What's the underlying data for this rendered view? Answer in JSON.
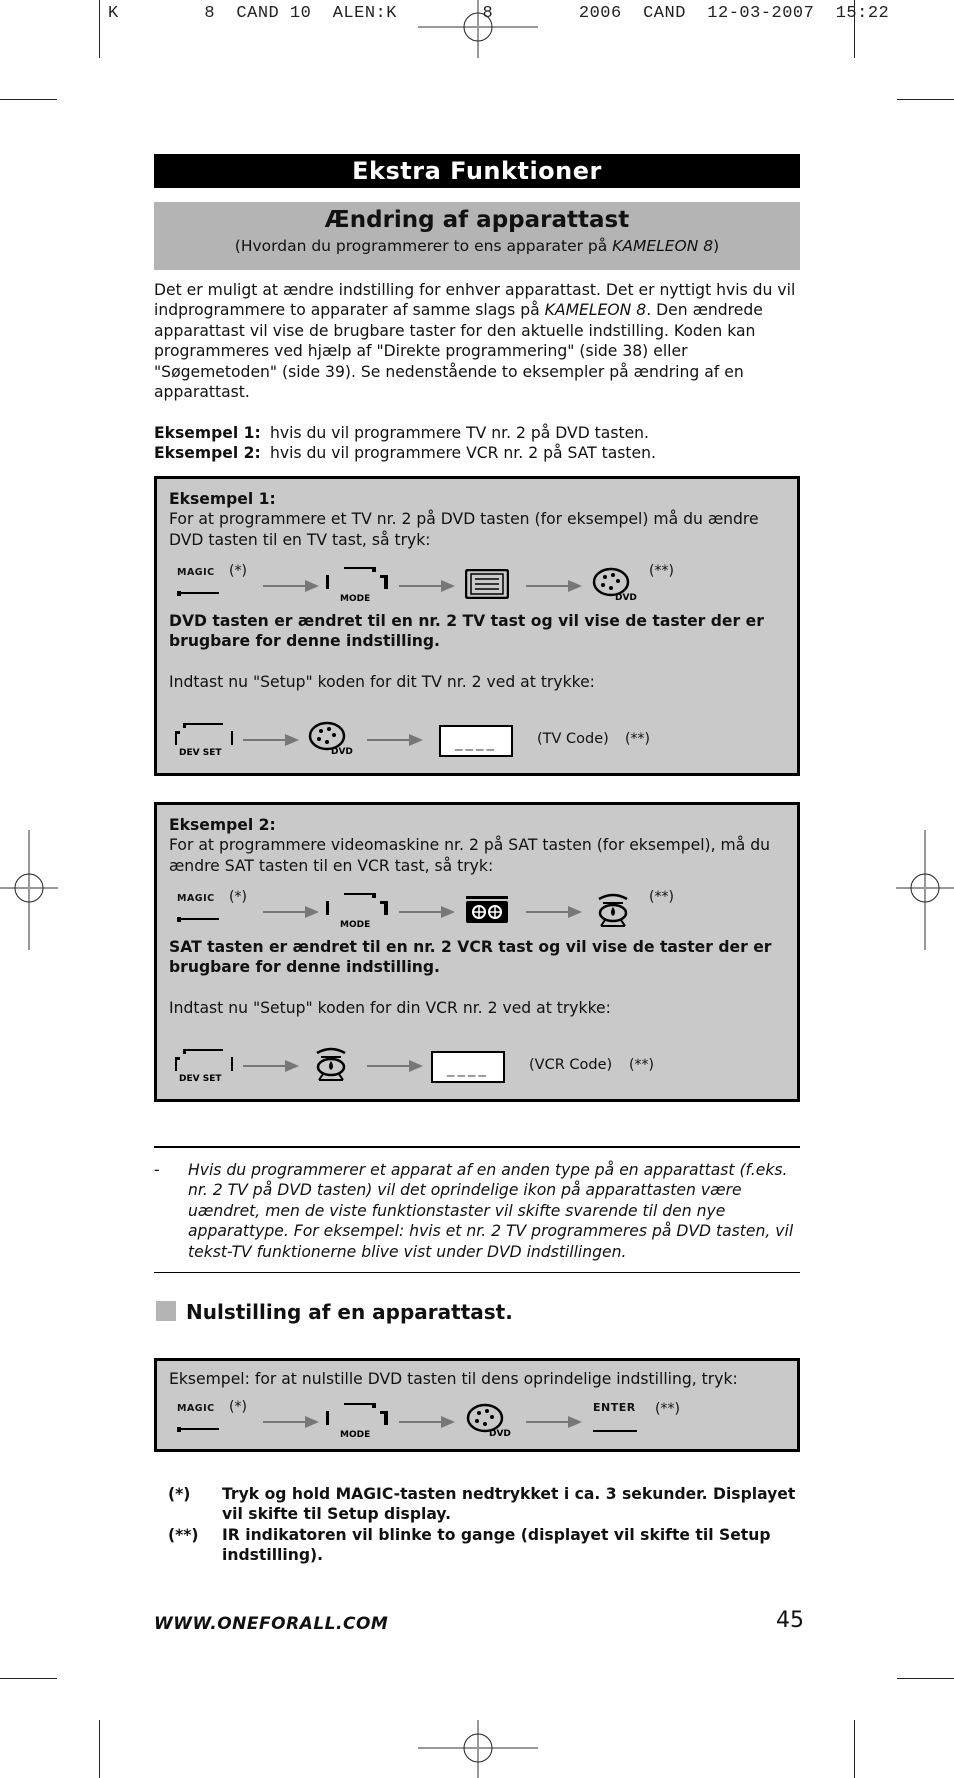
{
  "print_header": {
    "text": "K        8  CAND 10  ALEN:K        8        2006  CAND  12-03-2007  15:22"
  },
  "banner": {
    "title": "Ekstra Funktioner"
  },
  "section1": {
    "title": "Ændring af apparattast",
    "subtitle_prefix": "(Hvordan du programmerer to ens apparater på ",
    "subtitle_italic": "KAMELEON 8",
    "subtitle_suffix": ")"
  },
  "intro": {
    "part1": "Det er muligt at ændre indstilling for enhver apparattast. Det er nyttigt hvis du vil indprogrammere to apparater af samme slags på ",
    "italic": "KAMELEON 8",
    "part2": ". Den ændrede apparattast vil vise de brugbare taster for den aktuelle indstilling. Koden kan programmeres ved hjælp af \"Direkte programmering\" (side 38) eller \"Søgemetoden\" (side 39). Se nedenstående to eksempler på ændring af en apparattast."
  },
  "examples_summary": [
    {
      "label": "Eksempel 1:",
      "text": "hvis du vil programmere TV nr. 2 på DVD tasten."
    },
    {
      "label": "Eksempel 2:",
      "text": "hvis du vil programmere VCR nr. 2 på SAT tasten."
    }
  ],
  "keys": {
    "magic": "MAGIC",
    "mode": "MODE",
    "dvd": "DVD",
    "devset": "DEV SET",
    "enter": "ENTER",
    "star1": "(*)",
    "star2": "(**)",
    "code_placeholder": "____"
  },
  "example1": {
    "heading": "Eksempel 1:",
    "text": "For at programmere et TV nr. 2 på DVD tasten (for eksempel) må du ændre DVD tasten til en TV tast, så tryk:",
    "result": "DVD tasten er ændret til en nr. 2 TV tast og vil vise de taster der er brugbare for denne indstilling.",
    "instruction": "Indtast nu \"Setup\" koden for dit TV nr. 2 ved at trykke:",
    "code_label": "(TV Code)"
  },
  "example2": {
    "heading": "Eksempel 2:",
    "text": "For at programmere videomaskine nr. 2 på SAT tasten (for eksempel), må du ændre SAT tasten til en VCR tast, så tryk:",
    "result": "SAT tasten er ændret til en nr. 2 VCR tast og vil vise de taster der er brugbare for denne indstilling.",
    "instruction": "Indtast nu \"Setup\" koden for din VCR nr. 2 ved at trykke:",
    "code_label": "(VCR Code)"
  },
  "note": {
    "dash": "-",
    "text": "Hvis du programmerer et apparat af en anden type på en apparattast (f.eks. nr. 2 TV på DVD tasten) vil det oprindelige ikon på apparattasten være uændret, men de viste funktionstaster vil skifte svarende til den nye apparattype. For eksempel: hvis et nr. 2 TV programmeres på DVD tasten, vil tekst-TV funktionerne blive vist under DVD indstillingen."
  },
  "section2": {
    "title": "Nulstilling af en apparattast.",
    "example_text": "Eksempel: for at nulstille DVD tasten til dens oprindelige indstilling, tryk:"
  },
  "footnotes": [
    {
      "mark": "(*)",
      "text": "Tryk og hold MAGIC-tasten nedtrykket i ca. 3 sekunder. Displayet vil skifte til Setup display."
    },
    {
      "mark": "(**)",
      "text": "IR indikatoren vil blinke to gange (displayet vil skifte til Setup indstilling)."
    }
  ],
  "footer": {
    "url": "WWW.ONEFORALL.COM",
    "page_number": "45"
  }
}
